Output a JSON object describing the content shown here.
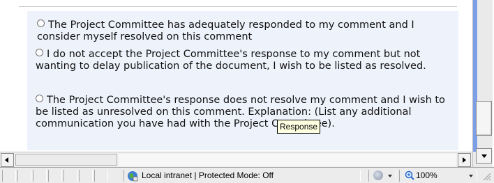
{
  "content": {
    "options": [
      {
        "label": "The Project Committee has adequately responded to my comment and I consider myself resolved on this comment"
      },
      {
        "label": "I do not accept the Project Committee's response to my comment but not wanting to delay publication of the document, I wish to be listed as resolved."
      },
      {
        "label": "The Project Committee's response does not resolve my comment and I wish to be listed as unresolved on this comment. Explanation: (List any additional communication you have had with the Project Committee)."
      }
    ],
    "tooltip": "Response"
  },
  "statusbar": {
    "zone_text": "Local intranet | Protected Mode: Off",
    "zoom_text": "100%"
  },
  "colors": {
    "panel_background": "#eef2fb",
    "tooltip_background": "#ffffe1",
    "scrollbar_accent": "#7b9ee6"
  },
  "icons": [
    "globe-icon",
    "addon-icon",
    "zoom-icon",
    "resize-grip-icon",
    "arrow-down-icon",
    "arrow-left-icon",
    "arrow-right-icon"
  ]
}
